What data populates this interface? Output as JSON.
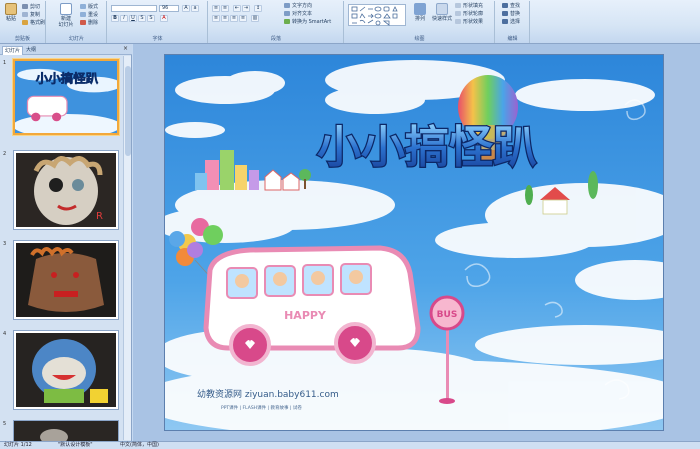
{
  "ribbon": {
    "clipboard": {
      "label": "剪贴板",
      "paste": "粘贴",
      "cut": "剪切",
      "copy": "复制",
      "format": "格式刷"
    },
    "slides": {
      "label": "幻灯片",
      "new_slide": "新建\n幻灯片",
      "layout": "版式",
      "reset": "重设",
      "delete": "删除"
    },
    "font": {
      "label": "字体",
      "size": "96"
    },
    "paragraph": {
      "label": "段落",
      "text_direction": "文字方向",
      "align_text": "对齐文本",
      "smartart": "转换为 SmartArt"
    },
    "drawing": {
      "label": "绘图",
      "arrange": "排列",
      "quick_styles": "快速样式",
      "fill": "形状填充",
      "outline": "形状轮廓",
      "effects": "形状效果"
    },
    "editing": {
      "label": "编辑",
      "find": "查找",
      "replace": "替换",
      "select": "选择"
    }
  },
  "left_pane": {
    "tab_slides": "幻灯片",
    "tab_outline": "大纲",
    "close": "×",
    "thumbnails": [
      {
        "num": "1"
      },
      {
        "num": "2"
      },
      {
        "num": "3"
      },
      {
        "num": "4"
      },
      {
        "num": "5"
      }
    ]
  },
  "slide": {
    "title": "小小搞怪趴",
    "bus_text": "HAPPY",
    "bus_sign": "BUS",
    "watermark_main": "幼教资源网 ziyuan.baby611.com",
    "watermark_sub": "PPT课件 | FLASH课件 | 教育故事 | 试卷"
  },
  "status": {
    "slide_info": "幻灯片 1/12",
    "theme": "\"默认设计模板\"",
    "language": "中文(简体，中国)"
  },
  "colors": {
    "ribbon_bg": "#dbe7f6",
    "selected_thumb": "#f2a83b",
    "sky": "#3a8fdc"
  }
}
